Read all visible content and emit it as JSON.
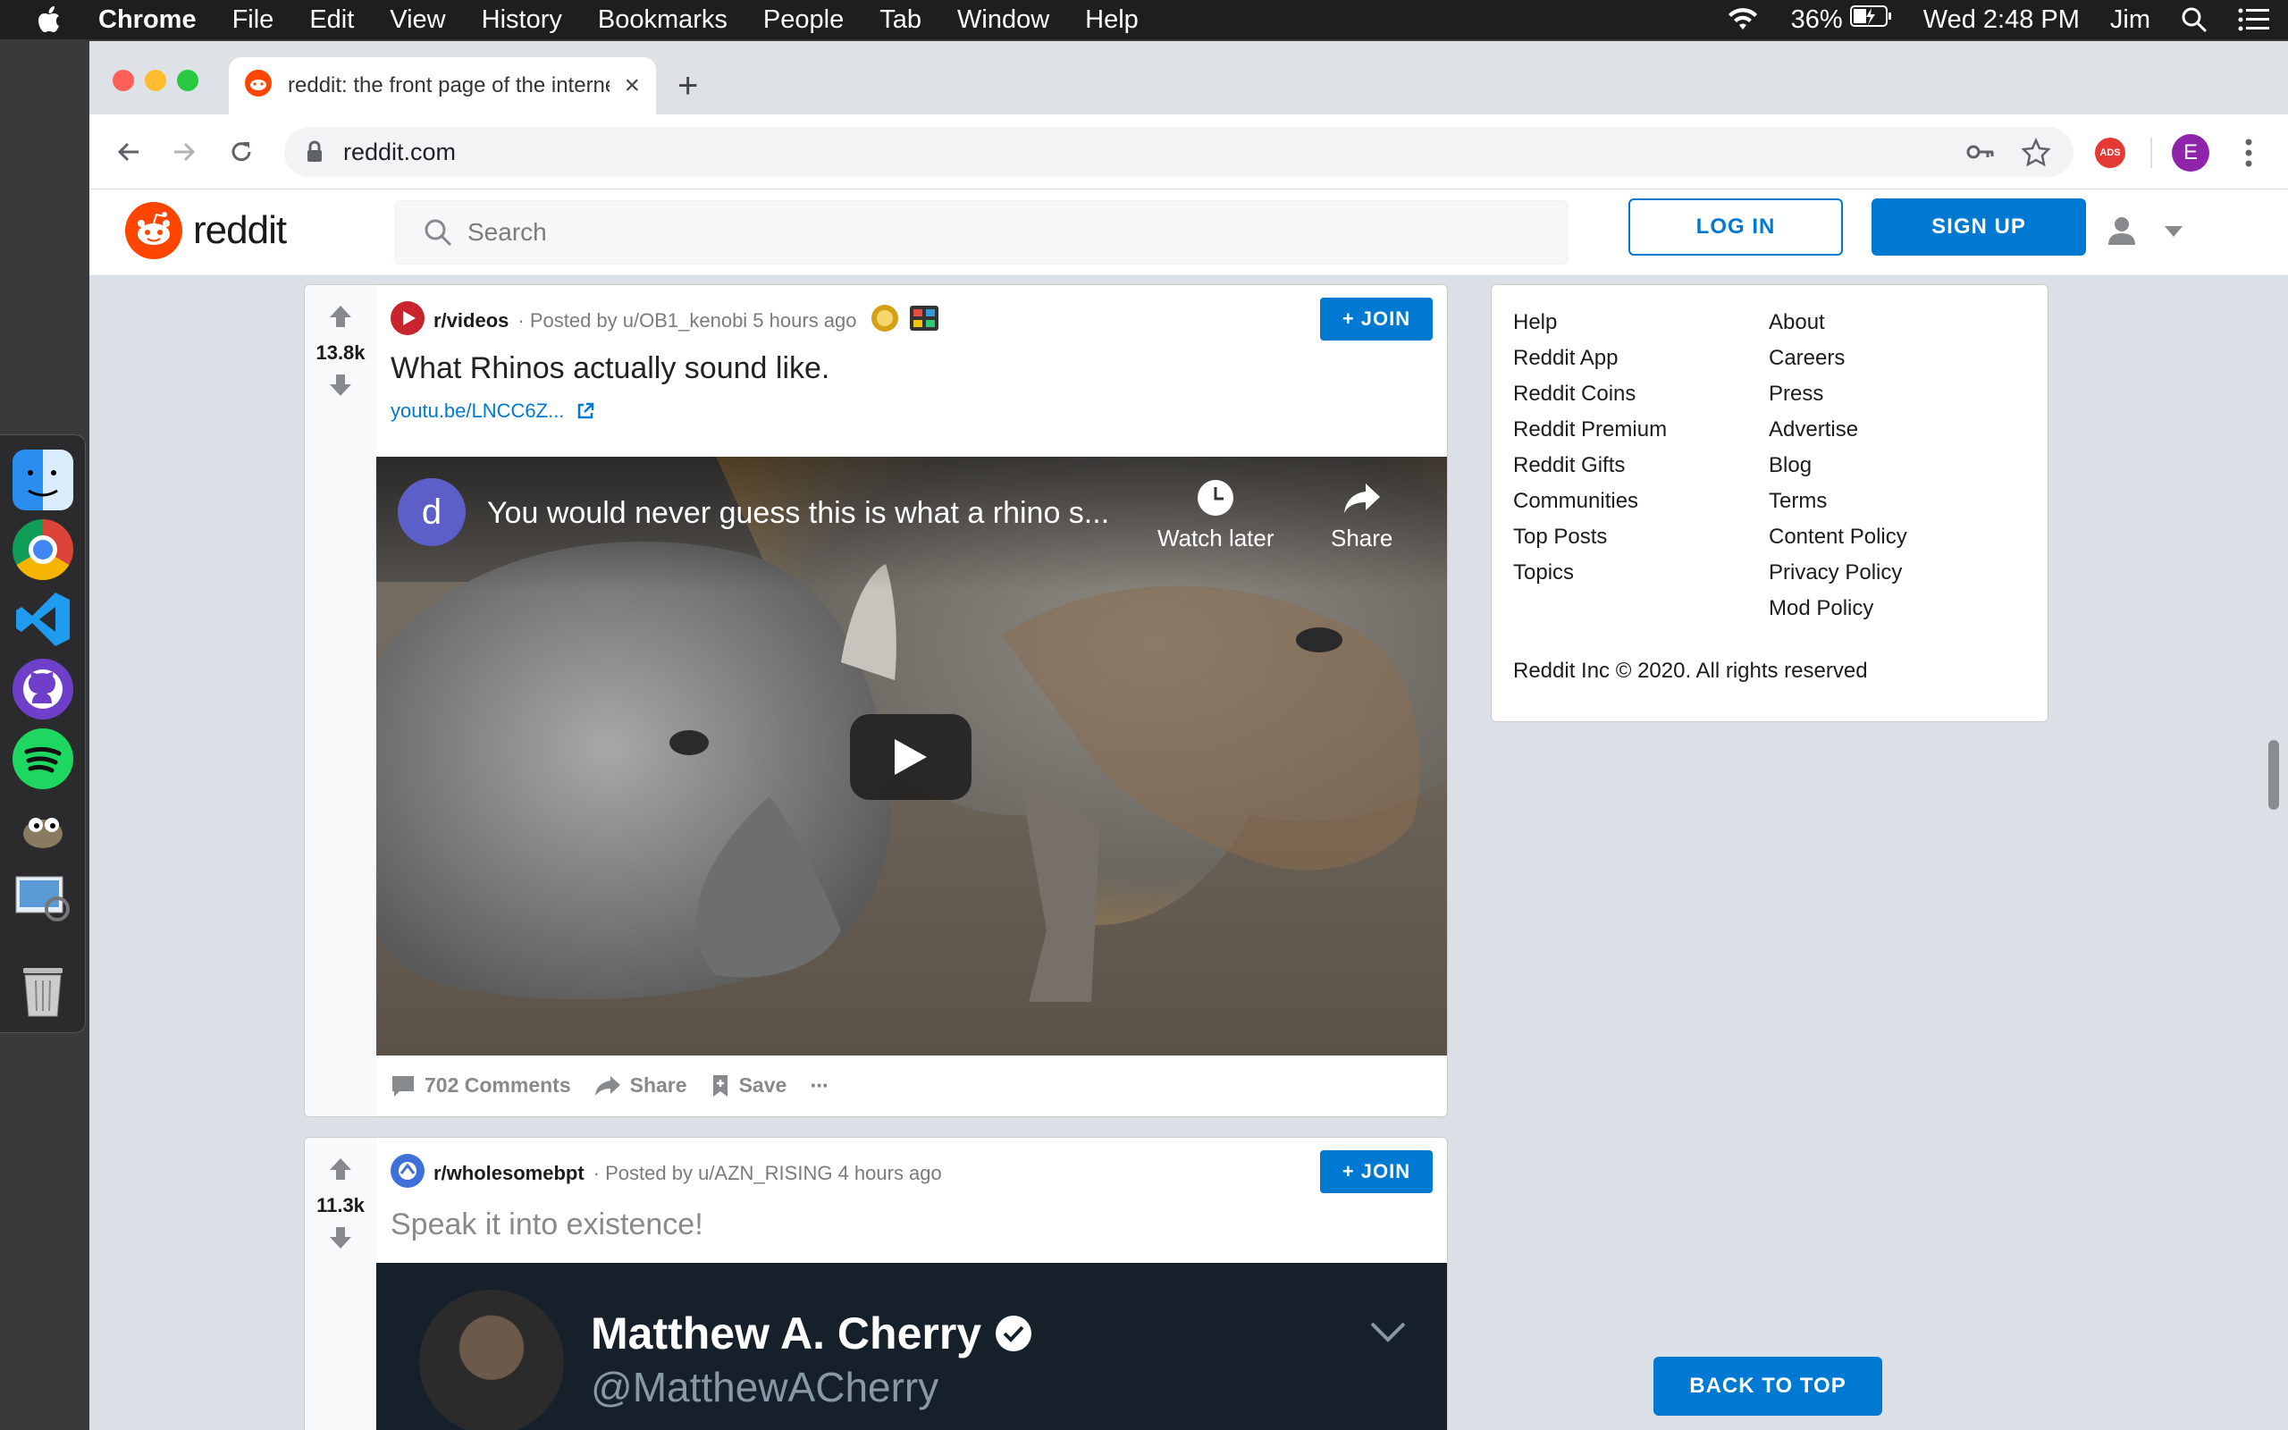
{
  "menubar": {
    "app": "Chrome",
    "items": [
      "File",
      "Edit",
      "View",
      "History",
      "Bookmarks",
      "People",
      "Tab",
      "Window",
      "Help"
    ],
    "battery": "36%",
    "clock": "Wed 2:48 PM",
    "user": "Jim"
  },
  "browser": {
    "tab_title": "reddit: the front page of the internet",
    "url": "reddit.com",
    "profile_initial": "E",
    "ext_badge": "ADS"
  },
  "reddit": {
    "wordmark": "reddit",
    "search_placeholder": "Search",
    "login": "LOG IN",
    "signup": "SIGN UP"
  },
  "posts": [
    {
      "score": "13.8k",
      "subreddit": "r/videos",
      "posted_by": "· Posted by u/OB1_kenobi 5 hours ago",
      "join": "+ JOIN",
      "title": "What Rhinos actually sound like.",
      "link": "youtu.be/LNCC6Z...",
      "video": {
        "channel_initial": "d",
        "title": "You would never guess this is what a rhino s...",
        "watch_later": "Watch later",
        "share": "Share"
      },
      "comments": "702 Comments",
      "share": "Share",
      "save": "Save",
      "more": "···"
    },
    {
      "score": "11.3k",
      "subreddit": "r/wholesomebpt",
      "posted_by": "· Posted by u/AZN_RISING 4 hours ago",
      "join": "+ JOIN",
      "title": "Speak it into existence!",
      "tweet": {
        "name": "Matthew A. Cherry",
        "handle": "@MatthewACherry"
      }
    }
  ],
  "sidebar": {
    "col1": [
      "Help",
      "Reddit App",
      "Reddit Coins",
      "Reddit Premium",
      "Reddit Gifts",
      "Communities",
      "Top Posts",
      "Topics"
    ],
    "col2": [
      "About",
      "Careers",
      "Press",
      "Advertise",
      "Blog",
      "Terms",
      "Content Policy",
      "Privacy Policy",
      "Mod Policy"
    ],
    "copyright": "Reddit Inc © 2020. All rights reserved"
  },
  "back_to_top": "BACK TO TOP",
  "colors": {
    "reddit_orange": "#ff4500",
    "reddit_blue": "#0079d3",
    "page_bg": "#dae0e6"
  }
}
